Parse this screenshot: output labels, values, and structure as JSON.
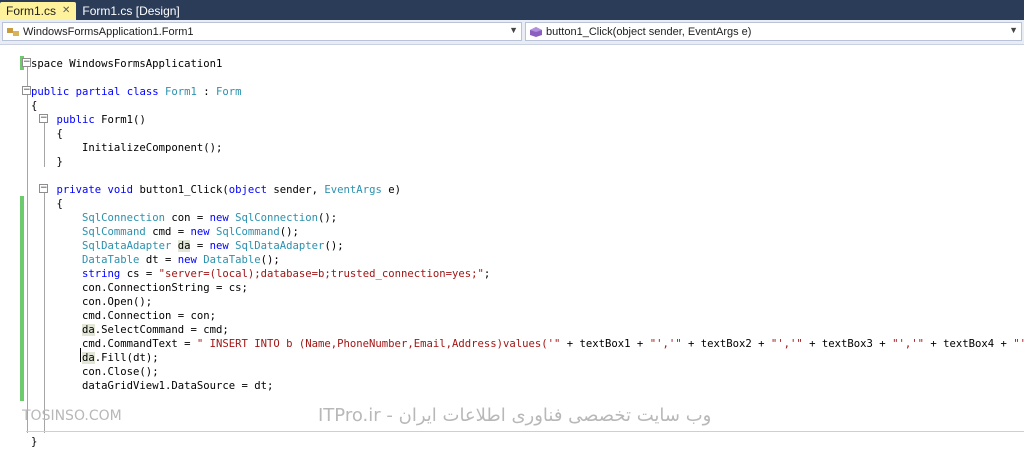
{
  "tabs": [
    {
      "label": "Form1.cs",
      "active": true
    },
    {
      "label": "Form1.cs [Design]",
      "active": false
    }
  ],
  "nav": {
    "left_combo": "WindowsFormsApplication1.Form1",
    "right_combo": "button1_Click(object sender, EventArgs e)"
  },
  "code": {
    "lines": [
      {
        "indent": "",
        "tokens": [
          {
            "t": "space WindowsFormsApplication1",
            "c": ""
          }
        ]
      },
      {
        "indent": "",
        "tokens": []
      },
      {
        "indent": "",
        "tokens": [
          {
            "t": "public ",
            "c": "kw"
          },
          {
            "t": "partial ",
            "c": "kw"
          },
          {
            "t": "class ",
            "c": "kw"
          },
          {
            "t": "Form1",
            "c": "ty"
          },
          {
            "t": " : ",
            "c": ""
          },
          {
            "t": "Form",
            "c": "ty"
          }
        ]
      },
      {
        "indent": "",
        "tokens": [
          {
            "t": "{",
            "c": ""
          }
        ]
      },
      {
        "indent": "    ",
        "tokens": [
          {
            "t": "public ",
            "c": "kw"
          },
          {
            "t": "Form1()",
            "c": ""
          }
        ]
      },
      {
        "indent": "    ",
        "tokens": [
          {
            "t": "{",
            "c": ""
          }
        ]
      },
      {
        "indent": "        ",
        "tokens": [
          {
            "t": "InitializeComponent();",
            "c": ""
          }
        ]
      },
      {
        "indent": "    ",
        "tokens": [
          {
            "t": "}",
            "c": ""
          }
        ]
      },
      {
        "indent": "",
        "tokens": []
      },
      {
        "indent": "    ",
        "tokens": [
          {
            "t": "private ",
            "c": "kw"
          },
          {
            "t": "void ",
            "c": "kw"
          },
          {
            "t": "button1_Click(",
            "c": ""
          },
          {
            "t": "object",
            "c": "kw"
          },
          {
            "t": " sender, ",
            "c": ""
          },
          {
            "t": "EventArgs",
            "c": "ty"
          },
          {
            "t": " e)",
            "c": ""
          }
        ]
      },
      {
        "indent": "    ",
        "tokens": [
          {
            "t": "{",
            "c": ""
          }
        ]
      },
      {
        "indent": "        ",
        "tokens": [
          {
            "t": "SqlConnection",
            "c": "ty"
          },
          {
            "t": " con = ",
            "c": ""
          },
          {
            "t": "new ",
            "c": "kw"
          },
          {
            "t": "SqlConnection",
            "c": "ty"
          },
          {
            "t": "();",
            "c": ""
          }
        ]
      },
      {
        "indent": "        ",
        "tokens": [
          {
            "t": "SqlCommand",
            "c": "ty"
          },
          {
            "t": " cmd = ",
            "c": ""
          },
          {
            "t": "new ",
            "c": "kw"
          },
          {
            "t": "SqlCommand",
            "c": "ty"
          },
          {
            "t": "();",
            "c": ""
          }
        ]
      },
      {
        "indent": "        ",
        "tokens": [
          {
            "t": "SqlDataAdapter",
            "c": "ty"
          },
          {
            "t": " ",
            "c": ""
          },
          {
            "t": "da",
            "c": "hl"
          },
          {
            "t": " = ",
            "c": ""
          },
          {
            "t": "new ",
            "c": "kw"
          },
          {
            "t": "SqlDataAdapter",
            "c": "ty"
          },
          {
            "t": "();",
            "c": ""
          }
        ]
      },
      {
        "indent": "        ",
        "tokens": [
          {
            "t": "DataTable",
            "c": "ty"
          },
          {
            "t": " dt = ",
            "c": ""
          },
          {
            "t": "new ",
            "c": "kw"
          },
          {
            "t": "DataTable",
            "c": "ty"
          },
          {
            "t": "();",
            "c": ""
          }
        ]
      },
      {
        "indent": "        ",
        "tokens": [
          {
            "t": "string",
            "c": "kw"
          },
          {
            "t": " cs = ",
            "c": ""
          },
          {
            "t": "\"server=(local);database=b;trusted_connection=yes;\"",
            "c": "st"
          },
          {
            "t": ";",
            "c": ""
          }
        ]
      },
      {
        "indent": "        ",
        "tokens": [
          {
            "t": "con.ConnectionString = cs;",
            "c": ""
          }
        ]
      },
      {
        "indent": "        ",
        "tokens": [
          {
            "t": "con.Open();",
            "c": ""
          }
        ]
      },
      {
        "indent": "        ",
        "tokens": [
          {
            "t": "cmd.Connection = con;",
            "c": ""
          }
        ]
      },
      {
        "indent": "        ",
        "tokens": [
          {
            "t": "da",
            "c": "hl"
          },
          {
            "t": ".SelectCommand = cmd;",
            "c": ""
          }
        ]
      },
      {
        "indent": "        ",
        "tokens": [
          {
            "t": "cmd.CommandText = ",
            "c": ""
          },
          {
            "t": "\" INSERT INTO b (Name,PhoneNumber,Email,Address)values('\"",
            "c": "st"
          },
          {
            "t": " + textBox1 + ",
            "c": ""
          },
          {
            "t": "\"','\"",
            "c": "st"
          },
          {
            "t": " + textBox2 + ",
            "c": ""
          },
          {
            "t": "\"','\"",
            "c": "st"
          },
          {
            "t": " + textBox3 + ",
            "c": ""
          },
          {
            "t": "\"','\"",
            "c": "st"
          },
          {
            "t": " + textBox4 + ",
            "c": ""
          },
          {
            "t": "\"'); \"",
            "c": "st"
          },
          {
            "t": ";",
            "c": ""
          }
        ]
      },
      {
        "indent": "        ",
        "tokens": [
          {
            "t": "da",
            "c": "hl"
          },
          {
            "t": ".Fill(dt);",
            "c": ""
          }
        ]
      },
      {
        "indent": "        ",
        "tokens": [
          {
            "t": "con.Close();",
            "c": ""
          }
        ]
      },
      {
        "indent": "        ",
        "tokens": [
          {
            "t": "dataGridView1.DataSource = dt;",
            "c": ""
          }
        ]
      },
      {
        "indent": "",
        "tokens": []
      },
      {
        "indent": "",
        "tokens": []
      },
      {
        "indent": "",
        "tokens": []
      },
      {
        "indent": "",
        "tokens": [
          {
            "t": "}",
            "c": ""
          }
        ]
      }
    ]
  },
  "watermarks": {
    "left": "TOSINSO.COM",
    "center": "ITPro.ir - وب سایت تخصصی فناوری اطلاعات ایران"
  },
  "colors": {
    "keyword": "#0000ff",
    "type": "#2b91af",
    "string": "#a31515",
    "change_bar": "#6ccb6c",
    "active_tab": "#fff29d",
    "tab_strip": "#2b3c59"
  }
}
